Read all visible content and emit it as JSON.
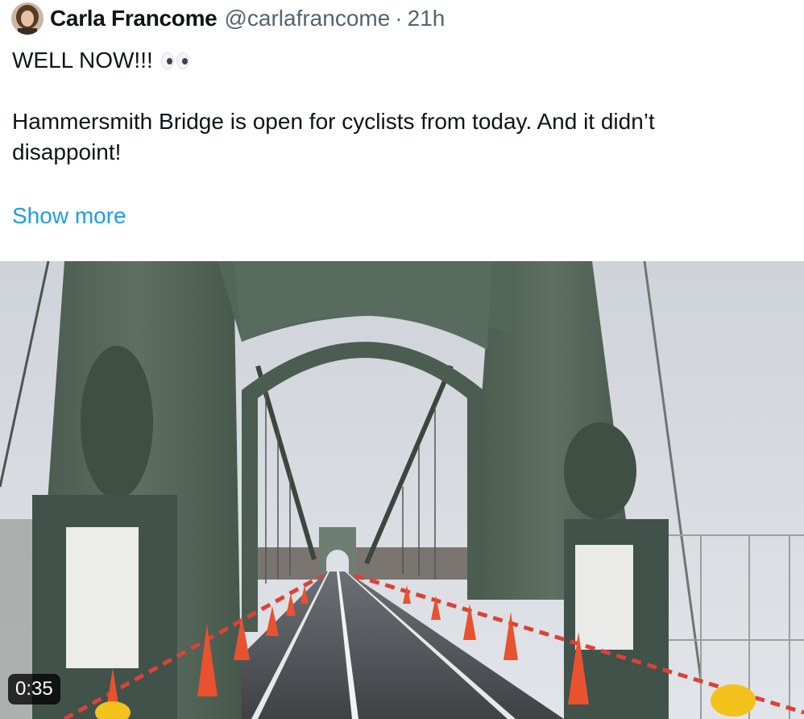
{
  "author": {
    "display_name": "Carla Francome",
    "handle": "@carlafrancome",
    "separator": "·",
    "time": "21h"
  },
  "tweet": {
    "headline": "WELL NOW!!!",
    "headline_emoji": "eyes-emoji",
    "paragraph_line1": "Hammersmith Bridge is open for cyclists from today. And it didn’t",
    "paragraph_line2": "disappoint!",
    "show_more": "Show more"
  },
  "media": {
    "type": "video",
    "duration": "0:35",
    "icon": "video-thumbnail"
  },
  "colors": {
    "link": "#1d9bf0",
    "secondary_text": "#536471",
    "bridge_green": "#56685a",
    "sky": "#d4d8de"
  }
}
